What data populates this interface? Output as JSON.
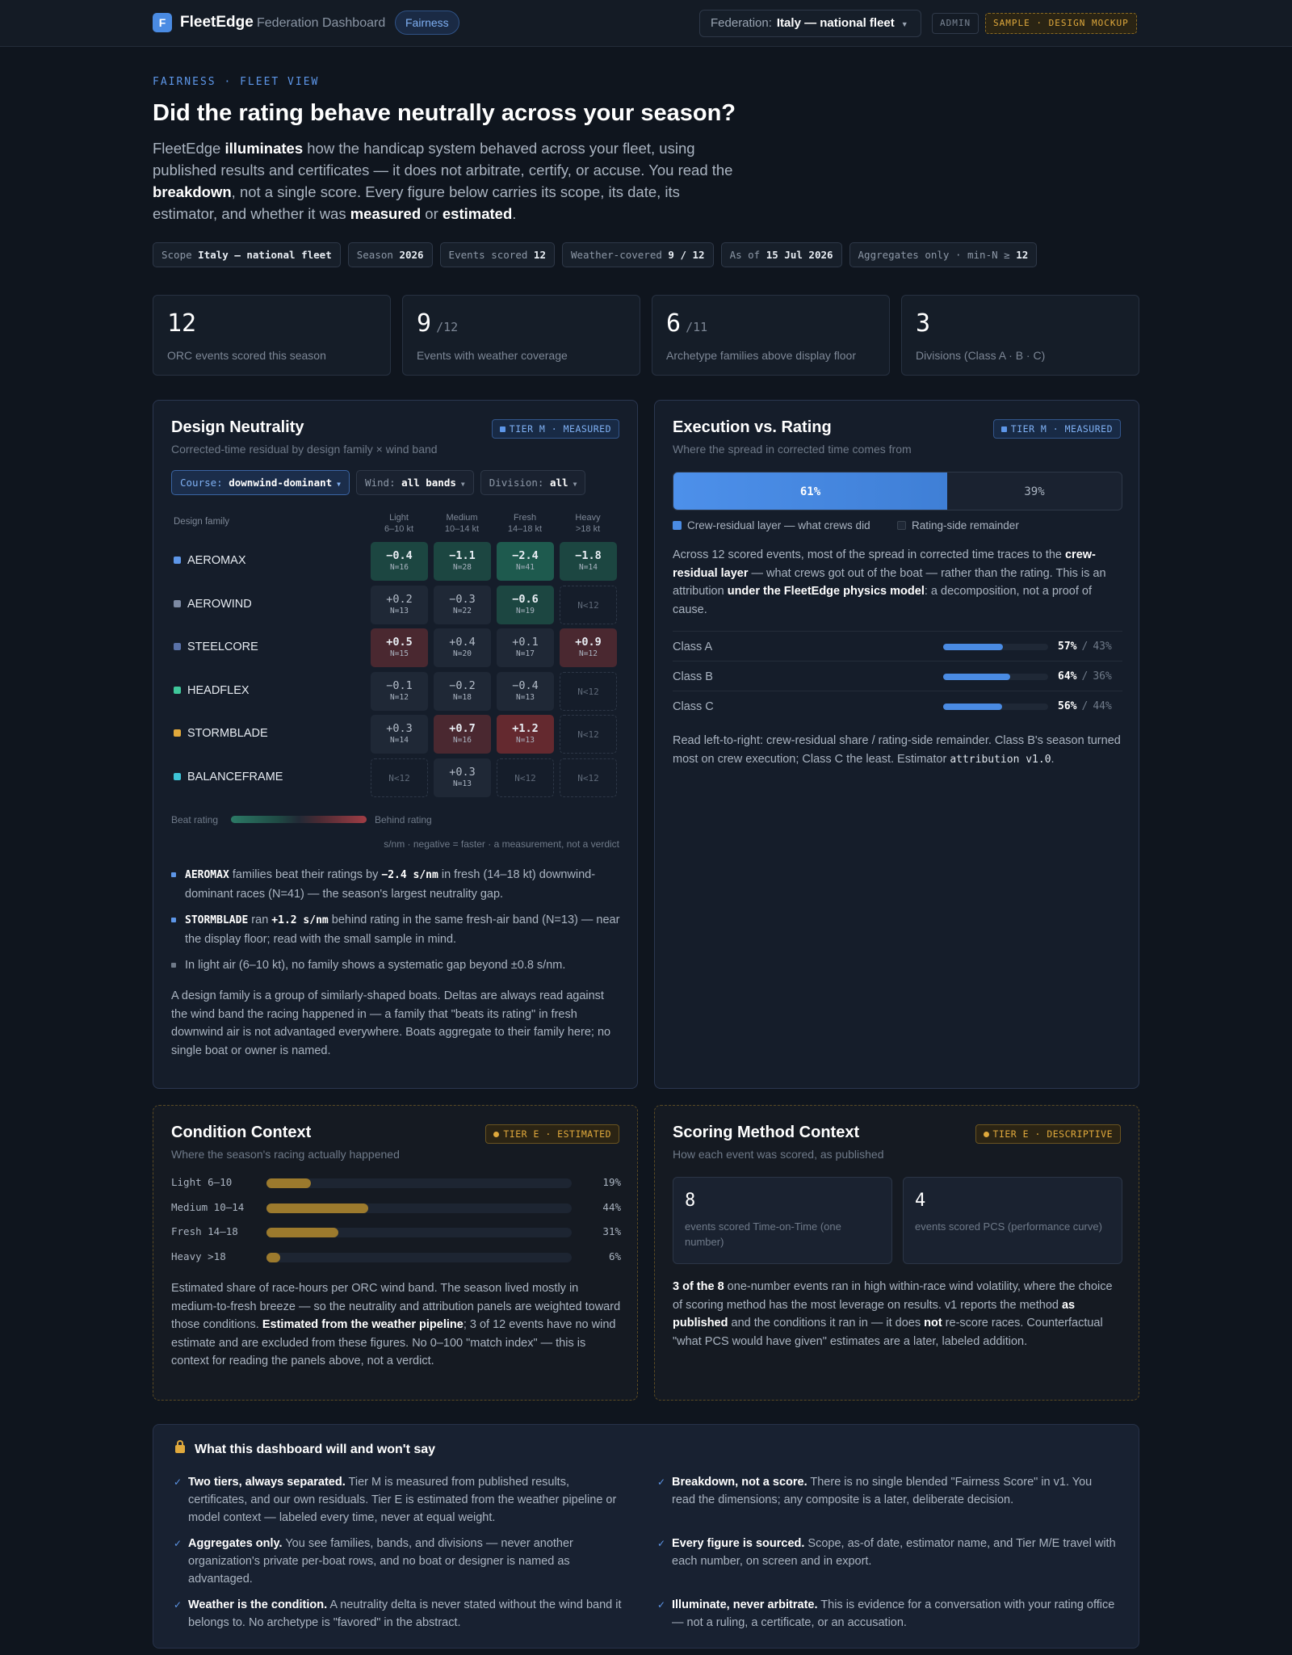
{
  "topbar": {
    "logo_letter": "F",
    "brand": "FleetEdge",
    "subtitle": "Federation Dashboard",
    "active_pill": "Fairness",
    "federation_label": "Federation:",
    "federation_value": "Italy — national fleet",
    "admin_badge": "ADMIN",
    "mockup_badge": "SAMPLE · DESIGN MOCKUP"
  },
  "hero": {
    "eyebrow": "FAIRNESS · FLEET VIEW",
    "title": "Did the rating behave neutrally across your season?",
    "lead_1": "FleetEdge ",
    "lead_b1": "illuminates",
    "lead_2": " how the handicap system behaved across your fleet, using published results and certificates — it does not arbitrate, certify, or accuse. You read the ",
    "lead_b2": "breakdown",
    "lead_3": ", not a single score. Every figure below carries its scope, its date, its estimator, and whether it was ",
    "lead_b3": "measured",
    "lead_4": " or ",
    "lead_b4": "estimated",
    "lead_5": "."
  },
  "chips": [
    {
      "label": "Scope",
      "value": "Italy — national fleet"
    },
    {
      "label": "Season",
      "value": "2026"
    },
    {
      "label": "Events scored",
      "value": "12"
    },
    {
      "label": "Weather-covered",
      "value": "9 / 12"
    },
    {
      "label": "As of",
      "value": "15 Jul 2026"
    },
    {
      "label": "Aggregates only · min-N ≥",
      "value": "12"
    }
  ],
  "stats": [
    {
      "value": "12",
      "of": "",
      "label": "ORC events scored this season"
    },
    {
      "value": "9",
      "of": "/12",
      "label": "Events with weather coverage"
    },
    {
      "value": "6",
      "of": "/11",
      "label": "Archetype families above display floor"
    },
    {
      "value": "3",
      "of": "",
      "label": "Divisions (Class A · B · C)"
    }
  ],
  "neutrality": {
    "title": "Design Neutrality",
    "subtitle": "Corrected-time residual by design family × wind band",
    "tier": "TIER M · MEASURED",
    "filters": [
      {
        "label": "Course:",
        "value": "downwind-dominant"
      },
      {
        "label": "Wind:",
        "value": "all bands"
      },
      {
        "label": "Division:",
        "value": "all"
      }
    ],
    "family_header": "Design family",
    "bands": [
      {
        "name": "Light",
        "range": "6–10 kt"
      },
      {
        "name": "Medium",
        "range": "10–14 kt"
      },
      {
        "name": "Fresh",
        "range": "14–18 kt"
      },
      {
        "name": "Heavy",
        "range": ">18 kt"
      }
    ],
    "rows": [
      {
        "family": "AEROMAX",
        "color": "#5d96e8",
        "cells": [
          {
            "v": "−0.4",
            "n": "N=16",
            "t": "g2"
          },
          {
            "v": "−1.1",
            "n": "N=28",
            "t": "g2"
          },
          {
            "v": "−2.4",
            "n": "N=41",
            "t": "g3"
          },
          {
            "v": "−1.8",
            "n": "N=14",
            "t": "g2"
          }
        ]
      },
      {
        "family": "AEROWIND",
        "color": "#7d8aa3",
        "cells": [
          {
            "v": "+0.2",
            "n": "N=13",
            "t": "neu"
          },
          {
            "v": "−0.3",
            "n": "N=22",
            "t": "neu"
          },
          {
            "v": "−0.6",
            "n": "N=19",
            "t": "g2"
          },
          {
            "v": "",
            "n": "N<12",
            "t": "empty"
          }
        ]
      },
      {
        "family": "STEELCORE",
        "color": "#5a72a8",
        "cells": [
          {
            "v": "+0.5",
            "n": "N=15",
            "t": "r1"
          },
          {
            "v": "+0.4",
            "n": "N=20",
            "t": "neu"
          },
          {
            "v": "+0.1",
            "n": "N=17",
            "t": "neu"
          },
          {
            "v": "+0.9",
            "n": "N=12",
            "t": "r1"
          }
        ]
      },
      {
        "family": "HEADFLEX",
        "color": "#3fc79a",
        "cells": [
          {
            "v": "−0.1",
            "n": "N=12",
            "t": "neu"
          },
          {
            "v": "−0.2",
            "n": "N=18",
            "t": "neu"
          },
          {
            "v": "−0.4",
            "n": "N=13",
            "t": "neu"
          },
          {
            "v": "",
            "n": "N<12",
            "t": "empty"
          }
        ]
      },
      {
        "family": "STORMBLADE",
        "color": "#e0a93c",
        "cells": [
          {
            "v": "+0.3",
            "n": "N=14",
            "t": "neu"
          },
          {
            "v": "+0.7",
            "n": "N=16",
            "t": "r1"
          },
          {
            "v": "+1.2",
            "n": "N=13",
            "t": "r2"
          },
          {
            "v": "",
            "n": "N<12",
            "t": "empty"
          }
        ]
      },
      {
        "family": "BALANCEFRAME",
        "color": "#3ec4d6",
        "cells": [
          {
            "v": "",
            "n": "N<12",
            "t": "empty"
          },
          {
            "v": "+0.3",
            "n": "N=13",
            "t": "neu"
          },
          {
            "v": "",
            "n": "N<12",
            "t": "empty"
          },
          {
            "v": "",
            "n": "N<12",
            "t": "empty"
          }
        ]
      }
    ],
    "legend_left": "Beat rating",
    "legend_right": "Behind rating",
    "units_note": "s/nm · negative = faster · a measurement, not a verdict",
    "b1_fam": "AEROMAX",
    "b1_t1": " families beat their ratings by ",
    "b1_val": "−2.4 s/nm",
    "b1_t2": " in fresh (14–18 kt) downwind-dominant races (N=41) — the season's largest neutrality gap.",
    "b2_fam": "STORMBLADE",
    "b2_t1": " ran ",
    "b2_val": "+1.2 s/nm",
    "b2_t2": " behind rating in the same fresh-air band (N=13) — near the display floor; read with the small sample in mind.",
    "b3": "In light air (6–10 kt), no family shows a systematic gap beyond ±0.8 s/nm.",
    "para": "A design family is a group of similarly-shaped boats. Deltas are always read against the wind band the racing happened in — a family that \"beats its rating\" in fresh downwind air is not advantaged everywhere. Boats aggregate to their family here; no single boat or owner is named."
  },
  "execution": {
    "title": "Execution vs. Rating",
    "subtitle": "Where the spread in corrected time comes from",
    "tier": "TIER M · MEASURED",
    "crew_share": 61,
    "crew_pct": "61%",
    "rating_pct": "39%",
    "legend_crew": "Crew-residual layer — what crews did",
    "legend_rating": "Rating-side remainder",
    "p1": "Across 12 scored events, most of the spread in corrected time traces to the ",
    "p1_b1": "crew-residual layer",
    "p2": " — what crews got out of the boat — rather than the rating. This is an attribution ",
    "p2_b2": "under the FleetEdge physics model",
    "p3": ": a decomposition, not a proof of cause.",
    "classes": [
      {
        "name": "Class A",
        "crew": 57,
        "crew_label": "57%",
        "rest_label": "43%"
      },
      {
        "name": "Class B",
        "crew": 64,
        "crew_label": "64%",
        "rest_label": "36%"
      },
      {
        "name": "Class C",
        "crew": 56,
        "crew_label": "56%",
        "rest_label": "44%"
      }
    ],
    "slash": "/",
    "note_1": "Read left-to-right: crew-residual share / rating-side remainder. Class B's season turned most on crew execution; Class C the least. Estimator ",
    "note_code": "attribution v1.0",
    "note_2": "."
  },
  "conditions": {
    "title": "Condition Context",
    "subtitle": "Where the season's racing actually happened",
    "tier": "TIER E · ESTIMATED",
    "bands": [
      {
        "label": "Light 6–10",
        "share": 19,
        "pct": "19%"
      },
      {
        "label": "Medium 10–14",
        "share": 44,
        "pct": "44%"
      },
      {
        "label": "Fresh 14–18",
        "share": 31,
        "pct": "31%"
      },
      {
        "label": "Heavy >18",
        "share": 6,
        "pct": "6%"
      }
    ],
    "p1": "Estimated share of race-hours per ORC wind band. The season lived mostly in medium-to-fresh breeze — so the neutrality and attribution panels are weighted toward those conditions. ",
    "p_b": "Estimated from the weather pipeline",
    "p2": "; 3 of 12 events have no wind estimate and are excluded from these figures. No 0–100 \"match index\" — this is context for reading the panels above, not a verdict."
  },
  "scoring": {
    "title": "Scoring Method Context",
    "subtitle": "How each event was scored, as published",
    "tier": "TIER E · DESCRIPTIVE",
    "tot_value": "8",
    "tot_label": "events scored Time-on-Time (one number)",
    "pcs_value": "4",
    "pcs_label": "events scored PCS (performance curve)",
    "p_b1": "3 of the 8",
    "p1": " one-number events ran in high within-race wind volatility, where the choice of scoring method has the most leverage on results. v1 reports the method ",
    "p_b2": "as published",
    "p2": " and the conditions it ran in — it does ",
    "p_b3": "not",
    "p3": " re-score races. Counterfactual \"what PCS would have given\" estimates are a later, labeled addition."
  },
  "guarantees": {
    "title": "What this dashboard will and won't say",
    "items": [
      {
        "head": "Two tiers, always separated.",
        "body": " Tier M is measured from published results, certificates, and our own residuals. Tier E is estimated from the weather pipeline or model context — labeled every time, never at equal weight."
      },
      {
        "head": "Breakdown, not a score.",
        "body": " There is no single blended \"Fairness Score\" in v1. You read the dimensions; any composite is a later, deliberate decision."
      },
      {
        "head": "Aggregates only.",
        "body": " You see families, bands, and divisions — never another organization's private per-boat rows, and no boat or designer is named as advantaged."
      },
      {
        "head": "Every figure is sourced.",
        "body": " Scope, as-of date, estimator name, and Tier M/E travel with each number, on screen and in export."
      },
      {
        "head": "Weather is the condition.",
        "body": " A neutrality delta is never stated without the wind band it belongs to. No archetype is \"favored\" in the abstract."
      },
      {
        "head": "Illuminate, never arbitrate.",
        "body": " This is evidence for a conversation with your rating office — not a ruling, a certificate, or an accusation."
      }
    ]
  },
  "colors": {
    "accent": "#4a8be3",
    "estimated": "#e0a93c",
    "beat": "#1e5a4e",
    "behind": "#64292f"
  },
  "icons": {
    "lock": "lock-icon",
    "check": "check-icon",
    "caret": "chevron-down-icon"
  }
}
